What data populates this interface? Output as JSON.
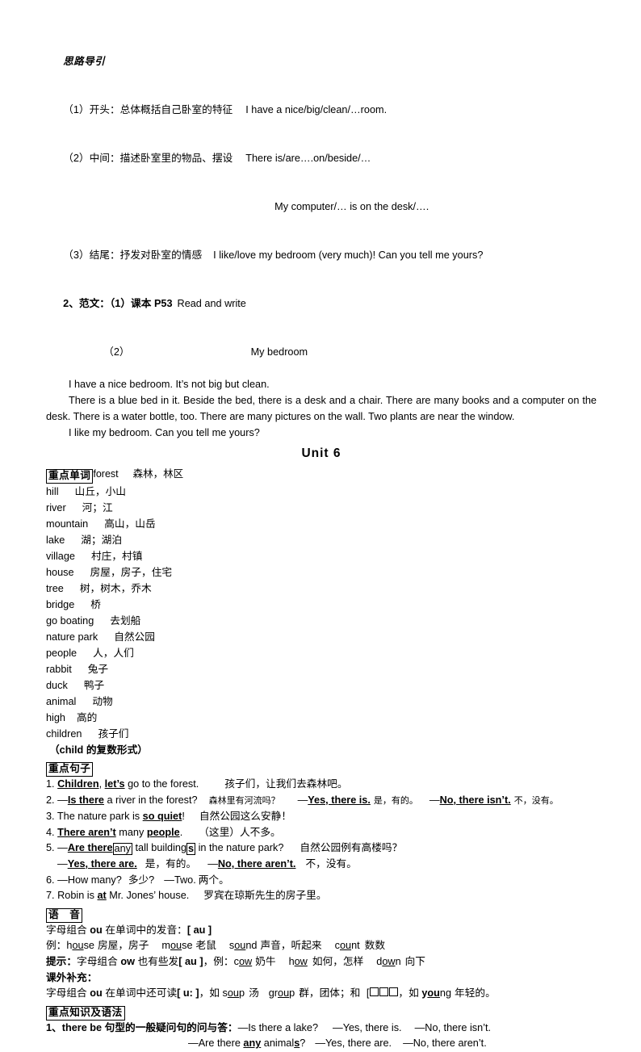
{
  "document": {
    "guide_heading": "思路导引",
    "guide_lines": [
      {
        "cn": "（1）开头：总体概括自己卧室的特征",
        "en": "I have a nice/big/clean/…room."
      },
      {
        "cn": "（2）中间：描述卧室里的物品、摆设",
        "en": "There is/are….on/beside/…"
      },
      {
        "cn": "",
        "en": "My computer/… is on the desk/…."
      },
      {
        "cn": "（3）结尾：抒发对卧室的情感",
        "en": "I like/love my bedroom (very much)! Can you tell me yours?"
      }
    ],
    "model_label_num": "2",
    "model_label": "、范文：（1）课本 P53",
    "model_label_en": "Read and write",
    "model_item2": "（2）",
    "model_title": "My bedroom",
    "model_paragraphs": [
      "I have a nice bedroom. It’s not big but clean.",
      "There is a blue bed in it. Beside the bed, there is a desk and a chair. There are many books and a computer on the desk. There is a water bottle, too. There are many pictures on the wall. Two plants are near the window.",
      "I like my bedroom. Can you tell me yours?"
    ],
    "unit_title": "Unit  6",
    "vocab_header": "重点单词",
    "vocab": [
      {
        "en": "forest",
        "cn": "森林，林区"
      },
      {
        "en": "hill",
        "cn": "山丘，小山"
      },
      {
        "en": "river",
        "cn": "河；江"
      },
      {
        "en": "mountain",
        "cn": "高山，山岳"
      },
      {
        "en": "lake",
        "cn": "湖；湖泊"
      },
      {
        "en": "village",
        "cn": "村庄，村镇"
      },
      {
        "en": "house",
        "cn": "房屋，房子，住宅"
      },
      {
        "en": "tree",
        "cn": "树，树木，乔木"
      },
      {
        "en": "bridge",
        "cn": "桥"
      },
      {
        "en": "go boating",
        "cn": "去划船"
      },
      {
        "en": "nature park",
        "cn": "自然公园"
      },
      {
        "en": "people",
        "cn": "人，人们"
      },
      {
        "en": "rabbit",
        "cn": "兔子"
      },
      {
        "en": "duck",
        "cn": "鸭子"
      },
      {
        "en": "animal",
        "cn": "动物"
      },
      {
        "en": "high",
        "cn": "高的"
      },
      {
        "en": "children",
        "cn": "孩子们"
      }
    ],
    "vocab_note": "（child 的复数形式）",
    "vocab_note_bold_word": "child",
    "sentences_header": "重点句子",
    "sentences": {
      "s1_num": "1.",
      "s1_a": "Children",
      "s1_b": ", ",
      "s1_c": "let’s",
      "s1_d": " go to the forest.",
      "s1_cn": "孩子们，让我们去森林吧。",
      "s2_num": "2.",
      "s2_dash": "—",
      "s2_a": "Is there",
      "s2_b": " a river in the forest?",
      "s2_cn1": "森林里有河流吗？",
      "s2_yes": "Yes, there is.",
      "s2_cn2": "是，有的。",
      "s2_no": "No, there isn’t.",
      "s2_cn3": "不，没有。",
      "s3_num": "3.",
      "s3_a": "The nature park is ",
      "s3_b": "so quiet",
      "s3_c": "!",
      "s3_cn": "自然公园这么安静！",
      "s4_num": "4.",
      "s4_a": "There aren’t",
      "s4_b": " many ",
      "s4_c": "people",
      "s4_d": ".",
      "s4_cn": "（这里）人不多。",
      "s5_num": "5.",
      "s5_a": "Are there",
      "s5_box": "any",
      "s5_b": " tall building",
      "s5_box2": "s",
      "s5_c": " in the nature park?",
      "s5_cn": "自然公园例有高楼吗？",
      "s5_yes": "Yes, there are.",
      "s5_cn2": "是，有的。",
      "s5_no": "No, there aren’t.",
      "s5_cn3": "不，没有。",
      "s6_num": "6.",
      "s6_q": "—How many?",
      "s6_cn1": "多少?",
      "s6_a": "—Two.",
      "s6_cn2": "两个。",
      "s7_num": "7.",
      "s7_a": "Robin is ",
      "s7_b": "at",
      "s7_c": " Mr. Jones’ house.",
      "s7_cn": "罗宾在琼斯先生的房子里。"
    },
    "phonics_header": "语　音",
    "phonics_rule_pre": "字母组合 ",
    "phonics_rule_combo": "ou",
    "phonics_rule_mid": " 在单词中的发音：",
    "phonics_rule_ipa": "[ au ]",
    "phonics_examples_label": "例：",
    "phonics_examples": [
      {
        "pre": "h",
        "mid": "ou",
        "post": "se",
        "cn": "房屋，房子"
      },
      {
        "pre": "m",
        "mid": "ou",
        "post": "se",
        "cn": "老鼠"
      },
      {
        "pre": "s",
        "mid": "ou",
        "post": "nd",
        "cn": "声音，听起来"
      },
      {
        "pre": "c",
        "mid": "ou",
        "post": "nt",
        "cn": "数数"
      }
    ],
    "phonics_tip_label": "提示：",
    "phonics_tip_pre": "字母组合 ",
    "phonics_tip_combo": "ow",
    "phonics_tip_mid": " 也有些发",
    "phonics_tip_ipa": "[ au ]",
    "phonics_tip_post": "，例：",
    "phonics_tip_examples": [
      {
        "pre": "c",
        "mid": "ow",
        "post": "",
        "cn": "奶牛"
      },
      {
        "pre": "h",
        "mid": "ow",
        "post": "",
        "cn": "如何，怎样"
      },
      {
        "pre": "d",
        "mid": "ow",
        "post": "n",
        "cn": "向下"
      }
    ],
    "extra_header": "课外补充：",
    "extra_pre": "字母组合 ",
    "extra_combo": "ou",
    "extra_mid": " 在单词中还可读",
    "extra_ipa": "[ u: ]",
    "extra_post": "，如 ",
    "extra_examples": [
      {
        "pre": "s",
        "mid": "ou",
        "post": "p",
        "cn": "汤"
      },
      {
        "pre": "gr",
        "mid": "ou",
        "post": "p",
        "cn": "群，团体"
      }
    ],
    "extra_tail_1": "；和 ",
    "extra_tail_bracket": "[",
    "extra_tail_2": "，如 ",
    "extra_tail_word": {
      "pre": "y",
      "mid": "ou",
      "post": "ng"
    },
    "extra_tail_cn": "年轻的。",
    "grammar_header": "重点知识及语法",
    "grammar_item_num": "1、",
    "grammar_item_bold_en": "there be",
    "grammar_item_cn": " 句型的一般疑问句的问与答：",
    "grammar_qa": [
      {
        "q": "—Is there a lake?",
        "yes": "—Yes, there is.",
        "no": "—No, there isn’t."
      },
      {
        "q_pre": "—Are there ",
        "q_bold": "any",
        "q_mid": " animal",
        "q_bold2": "s",
        "q_post": "?",
        "yes": "—Yes, there are.",
        "no": "—No, there aren’t."
      }
    ]
  }
}
